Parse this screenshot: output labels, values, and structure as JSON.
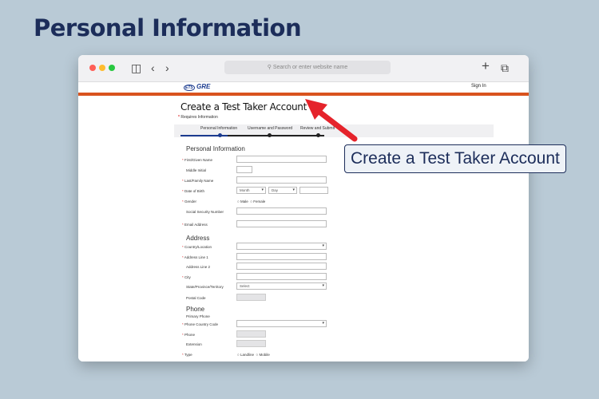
{
  "heading": "Personal Information",
  "browser": {
    "url_placeholder": "Search or enter website name"
  },
  "site": {
    "logo_prefix": "ETS",
    "logo_text": "GRE",
    "signin": "Sign In"
  },
  "form": {
    "title": "Create a Test Taker Account",
    "required_note": "Requires Information",
    "steps": [
      "Personal Information",
      "Username and Password",
      "Review and Submit"
    ],
    "sections": {
      "personal": "Personal Information",
      "address": "Address",
      "phone": "Phone"
    },
    "fields": {
      "first_name": "First/Given Name",
      "middle_initial": "Middle Initial",
      "last_name": "Last/Family Name",
      "dob": "Date of Birth",
      "dob_month": "Month",
      "dob_day": "Day",
      "gender": "Gender",
      "gender_male": "Male",
      "gender_female": "Female",
      "ssn": "Social Security Number",
      "email": "Email Address",
      "country": "Country/Location",
      "address1": "Address Line 1",
      "address2": "Address Line 2",
      "city": "City",
      "state": "State/Province/Territory",
      "state_value": "Select",
      "postal": "Postal Code",
      "primary_phone": "Primary Phone",
      "phone_country": "Phone Country Code",
      "phone": "Phone",
      "extension": "Extension",
      "type": "Type",
      "type_landline": "Landline",
      "type_mobile": "Mobile"
    }
  },
  "callout": "Create a Test Taker Account",
  "colors": {
    "accent_orange": "#d9531e",
    "heading_navy": "#1c2d5a",
    "arrow_red": "#e5232b"
  }
}
